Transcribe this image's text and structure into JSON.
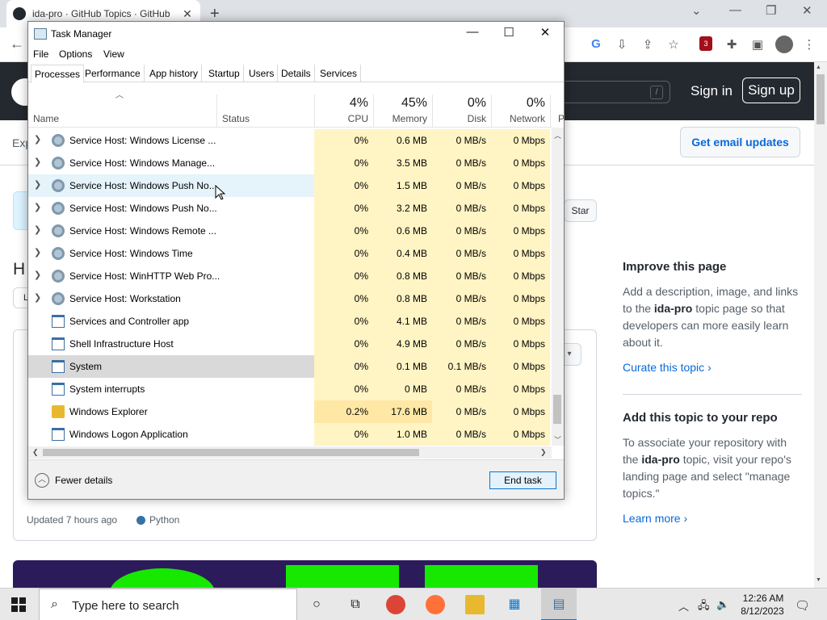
{
  "browser": {
    "tab_title": "ida-pro · GitHub Topics · GitHub",
    "tab_close": "✕",
    "new_tab": "+"
  },
  "github": {
    "signin": "Sign in",
    "signup": "Sign up",
    "search_slash": "/",
    "subbar_text": "Exp",
    "email_updates": "Get email updates",
    "star": "Star",
    "heading_fragment": "H",
    "small_box_fragment": "L",
    "updated": "Updated 7 hours ago",
    "language": "Python",
    "language_color": "#3572a5",
    "sidebar": {
      "improve_title": "Improve this page",
      "improve_text_1": "Add a description, image, and links to the ",
      "improve_topic": "ida-pro",
      "improve_text_2": " topic page so that developers can more easily learn about it.",
      "curate_link": "Curate this topic",
      "add_title": "Add this topic to your repo",
      "add_text_1": "To associate your repository with the ",
      "add_topic": "ida-pro",
      "add_text_2": " topic, visit your repo's landing page and select \"manage topics.\"",
      "learn_link": "Learn more"
    }
  },
  "task_manager": {
    "title": "Task Manager",
    "menu": [
      "File",
      "Options",
      "View"
    ],
    "tabs": [
      "Processes",
      "Performance",
      "App history",
      "Startup",
      "Users",
      "Details",
      "Services"
    ],
    "active_tab": "Processes",
    "columns": {
      "name": "Name",
      "status": "Status",
      "cpu_pct": "4%",
      "cpu": "CPU",
      "mem_pct": "45%",
      "mem": "Memory",
      "disk_pct": "0%",
      "disk": "Disk",
      "net_pct": "0%",
      "net": "Network",
      "power_fragment": "P"
    },
    "rows": [
      {
        "name": "Service Host: Windows License ...",
        "cpu": "0%",
        "mem": "0.6 MB",
        "disk": "0 MB/s",
        "net": "0 Mbps"
      },
      {
        "name": "Service Host: Windows Manage...",
        "cpu": "0%",
        "mem": "3.5 MB",
        "disk": "0 MB/s",
        "net": "0 Mbps"
      },
      {
        "name": "Service Host: Windows Push No...",
        "cpu": "0%",
        "mem": "1.5 MB",
        "disk": "0 MB/s",
        "net": "0 Mbps"
      },
      {
        "name": "Service Host: Windows Push No...",
        "cpu": "0%",
        "mem": "3.2 MB",
        "disk": "0 MB/s",
        "net": "0 Mbps"
      },
      {
        "name": "Service Host: Windows Remote ...",
        "cpu": "0%",
        "mem": "0.6 MB",
        "disk": "0 MB/s",
        "net": "0 Mbps"
      },
      {
        "name": "Service Host: Windows Time",
        "cpu": "0%",
        "mem": "0.4 MB",
        "disk": "0 MB/s",
        "net": "0 Mbps"
      },
      {
        "name": "Service Host: WinHTTP Web Pro...",
        "cpu": "0%",
        "mem": "0.8 MB",
        "disk": "0 MB/s",
        "net": "0 Mbps"
      },
      {
        "name": "Service Host: Workstation",
        "cpu": "0%",
        "mem": "0.8 MB",
        "disk": "0 MB/s",
        "net": "0 Mbps"
      },
      {
        "name": "Services and Controller app",
        "cpu": "0%",
        "mem": "4.1 MB",
        "disk": "0 MB/s",
        "net": "0 Mbps"
      },
      {
        "name": "Shell Infrastructure Host",
        "cpu": "0%",
        "mem": "4.9 MB",
        "disk": "0 MB/s",
        "net": "0 Mbps"
      },
      {
        "name": "System",
        "cpu": "0%",
        "mem": "0.1 MB",
        "disk": "0.1 MB/s",
        "net": "0 Mbps"
      },
      {
        "name": "System interrupts",
        "cpu": "0%",
        "mem": "0 MB",
        "disk": "0 MB/s",
        "net": "0 Mbps"
      },
      {
        "name": "Windows Explorer",
        "cpu": "0.2%",
        "mem": "17.6 MB",
        "disk": "0 MB/s",
        "net": "0 Mbps"
      },
      {
        "name": "Windows Logon Application",
        "cpu": "0%",
        "mem": "1.0 MB",
        "disk": "0 MB/s",
        "net": "0 Mbps"
      }
    ],
    "fewer_details": "Fewer details",
    "end_task": "End task"
  },
  "taskbar": {
    "search_placeholder": "Type here to search",
    "time": "12:26 AM",
    "date": "8/12/2023"
  }
}
